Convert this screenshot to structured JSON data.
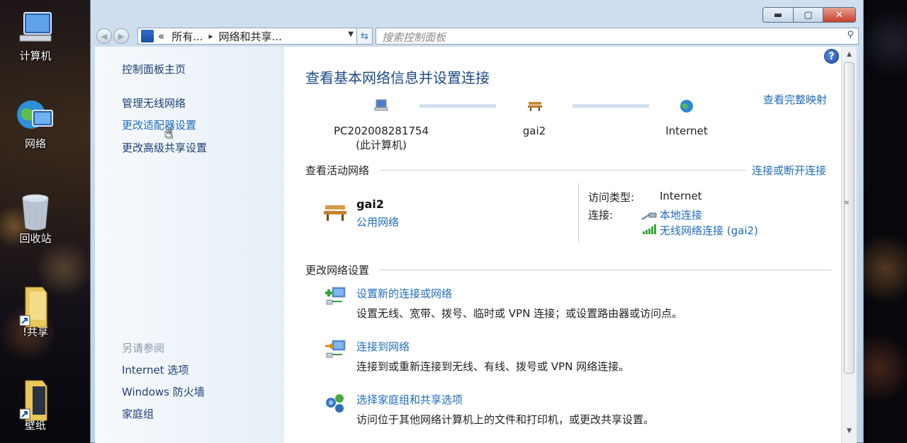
{
  "desktop": {
    "icons": [
      {
        "name": "computer",
        "label": "计算机"
      },
      {
        "name": "network",
        "label": "网络"
      },
      {
        "name": "recycle-bin",
        "label": "回收站"
      },
      {
        "name": "share-folder",
        "label": "!共享"
      },
      {
        "name": "wallpaper-folder",
        "label": "壁纸"
      }
    ]
  },
  "window": {
    "buttons": {
      "minimize": "▬",
      "maximize": "▢",
      "close": "✕"
    },
    "address": {
      "crumb_prefix": "«",
      "crumb_1": "所有...",
      "crumb_sep": "▸",
      "crumb_2": "网络和共享..."
    },
    "search_placeholder": "搜索控制面板"
  },
  "sidebar": {
    "home": "控制面板主页",
    "items": [
      "管理无线网络",
      "更改适配器设置",
      "更改高级共享设置"
    ],
    "see_also_title": "另请参阅",
    "see_also": [
      "Internet 选项",
      "Windows 防火墙",
      "家庭组"
    ]
  },
  "main": {
    "title": "查看基本网络信息并设置连接",
    "full_map_link": "查看完整映射",
    "map": {
      "computer_line1": "PC202008281754",
      "computer_line2": "(此计算机)",
      "network": "gai2",
      "internet": "Internet"
    },
    "active": {
      "header": "查看活动网络",
      "connect_link": "连接或断开连接",
      "name": "gai2",
      "type": "公用网络",
      "access_label": "访问类型:",
      "access_value": "Internet",
      "conn_label": "连接:",
      "conn_local": "本地连接",
      "conn_wireless": "无线网络连接 (gai2)"
    },
    "change": {
      "header": "更改网络设置",
      "tasks": [
        {
          "title": "设置新的连接或网络",
          "desc": "设置无线、宽带、拨号、临时或 VPN 连接；或设置路由器或访问点。"
        },
        {
          "title": "连接到网络",
          "desc": "连接到或重新连接到无线、有线、拨号或 VPN 网络连接。"
        },
        {
          "title": "选择家庭组和共享选项",
          "desc": "访问位于其他网络计算机上的文件和打印机，或更改共享设置。"
        }
      ]
    }
  },
  "colors": {
    "link": "#1f6cb8",
    "title": "#1e4a86",
    "sidebar_bg": "#e6eef7"
  }
}
